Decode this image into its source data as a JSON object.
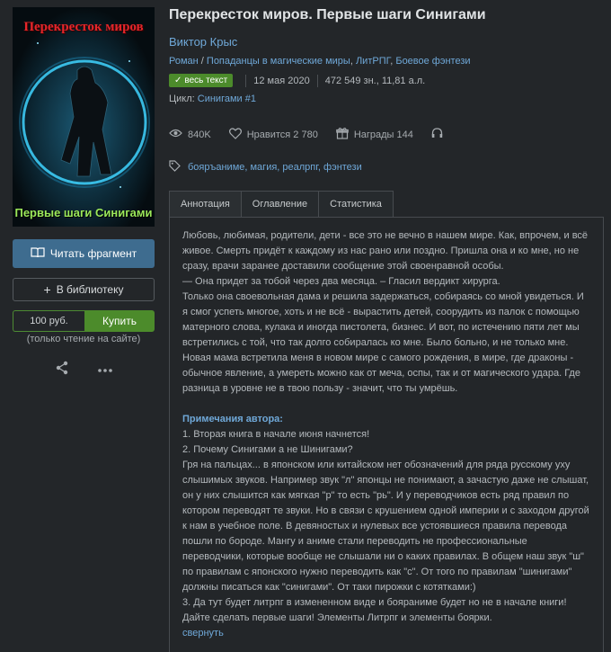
{
  "cover": {
    "title": "Перекресток миров",
    "subtitle": "Первые шаги Синигами"
  },
  "actions": {
    "read_label": "Читать фрагмент",
    "library_label": "В библиотеку",
    "price": "100 руб.",
    "buy_label": "Купить",
    "buy_note": "(только чтение на сайте)"
  },
  "book": {
    "title": "Перекресток миров. Первые шаги Синигами",
    "author": "Виктор Крыс",
    "genres": [
      "Роман",
      "Попаданцы в магические миры",
      "ЛитРПГ",
      "Боевое фэнтези"
    ],
    "status_badge": "весь текст",
    "date": "12 мая 2020",
    "size": "472 549 зн., 11,81 а.л.",
    "cycle_label": "Цикл:",
    "cycle_name": "Синигами #1",
    "views": "840K",
    "likes": "Нравится 2 780",
    "awards": "Награды 144",
    "tags": "бояръаниме, магия, реалрпг, фэнтези"
  },
  "tabs": [
    "Аннотация",
    "Оглавление",
    "Статистика"
  ],
  "annotation": {
    "p1": "Любовь, любимая, родители, дети - все это не вечно в нашем мире. Как, впрочем, и всё живое. Смерть придёт к каждому из нас рано или поздно. Пришла она и ко мне, но не сразу, врачи заранее доставили сообщение этой своенравной особы.",
    "p2": "— Она придет за тобой через два месяца. – Гласил вердикт хирурга.",
    "p3": "Только она своевольная дама и решила задержаться, собираясь со мной увидеться. И я смог успеть многое, хоть и не всё - вырастить детей, соорудить из палок с помощью матерного слова, кулака и иногда пистолета, бизнес. И вот, по истечению пяти лет мы встретились с той, что так долго собиралась ко мне. Было больно, и не только мне.",
    "p4": "Новая мама встретила меня в новом мире с самого рождения, в мире, где драконы - обычное явление, а умереть можно как от меча, оспы, так и от магического удара. Где разница в уровне не в твою пользу - значит, что ты умрёшь.",
    "notes_heading": "Примечания автора:",
    "n1": "1. Вторая книга в начале июня начнется!",
    "n2": "2. Почему Синигами а не Шинигами?",
    "n3": "Гря на пальцах... в японском или китайском нет обозначений для ряда русскому уху слышимых звуков. Например звук \"л\" японцы не понимают, а зачастую даже не слышат, он у них слышится как мягкая \"р\" то есть \"рь\". И у переводчиков есть ряд правил по котором переводят те звуки. Но в связи с крушением одной империи и с заходом другой к нам в учебное поле. В девяностых и нулевых все устоявшиеся правила перевода пошли по бороде. Мангу и аниме стали переводить не профессиональные переводчики, которые вообще не слышали ни о каких правилах. В общем наш звук \"ш\" по правилам с японского нужно переводить как \"с\". От того по правилам \"шинигами\" должны писаться как \"синигами\". От таки пирожки с котятками:)",
    "n4": "3. Да тут будет литрпг в измененном виде и бояраниме будет но не в начале книги! Дайте сделать первые шаги! Элементы Литрпг и элементы боярки.",
    "collapse": "свернуть"
  }
}
